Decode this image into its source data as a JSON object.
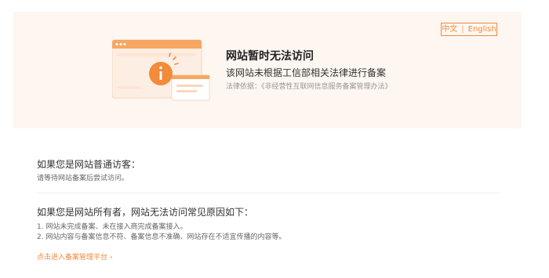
{
  "language_switch": {
    "chinese": "中文",
    "separator": "|",
    "english": "English"
  },
  "banner": {
    "illustration_icon": "info-icon",
    "title": "网站暂时无法访问",
    "subtitle": "该网站未根据工信部相关法律进行备案",
    "law_reference": "法律依据：《非经营性互联网信息服务备案管理办法》"
  },
  "visitor_section": {
    "heading": "如果您是网站普通访客：",
    "text": "请等待网站备案后尝试访问。"
  },
  "owner_section": {
    "heading": "如果您是网站所有者，网站无法访问常见原因如下：",
    "reasons": [
      "1. 网站未完成备案、未在接入商完成备案接入。",
      "2. 网站内容与备案信息不符、备案信息不准确、网站存在不适宜传播的内容等。"
    ]
  },
  "platform_link": {
    "label": "点击进入备案管理平台 ›"
  },
  "colors": {
    "accent": "#f08a3c",
    "banner_bg": "#fdf6f1"
  }
}
